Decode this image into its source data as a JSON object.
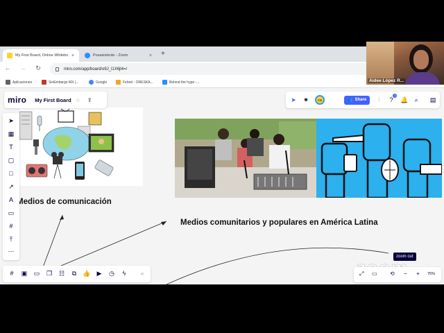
{
  "browser": {
    "tabs": [
      {
        "title": "My First Board, Online Whitebo",
        "active": true,
        "favicon_color": "#ffd02f"
      },
      {
        "title": "Posasistente - Zoom",
        "active": false,
        "favicon_color": "#2d8cff"
      }
    ],
    "new_tab_symbol": "+",
    "close_symbol": "×",
    "url": "miro.com/app/board/o9J_l1X6jl4=/",
    "bookmarks": [
      {
        "label": "Aplicaciones",
        "icon_color": "#5f6368"
      },
      {
        "label": "SinEmbargo MX |...",
        "icon_color": "#c0392b"
      },
      {
        "label": "Google",
        "icon_color": "#4285f4"
      },
      {
        "label": "Febrel - ORESKA...",
        "icon_color": "#f5a623"
      },
      {
        "label": "Behind the hype -...",
        "icon_color": "#2d8cff"
      }
    ]
  },
  "webcam": {
    "participant_name": "Aidee López R..."
  },
  "miro": {
    "logo": "miro",
    "board_name": "My First Board",
    "share_label": "Share",
    "avatar_initials": "CB",
    "notification_count": "1",
    "board_texts": {
      "medios": "Medios de comunicación",
      "comunitarios": "Medios comunitarios y populares en América Latina"
    },
    "zoom_percent": "75%",
    "tooltip": "zoom out",
    "zoom_watermark": "zoom",
    "accent_color": "#4262ff"
  }
}
